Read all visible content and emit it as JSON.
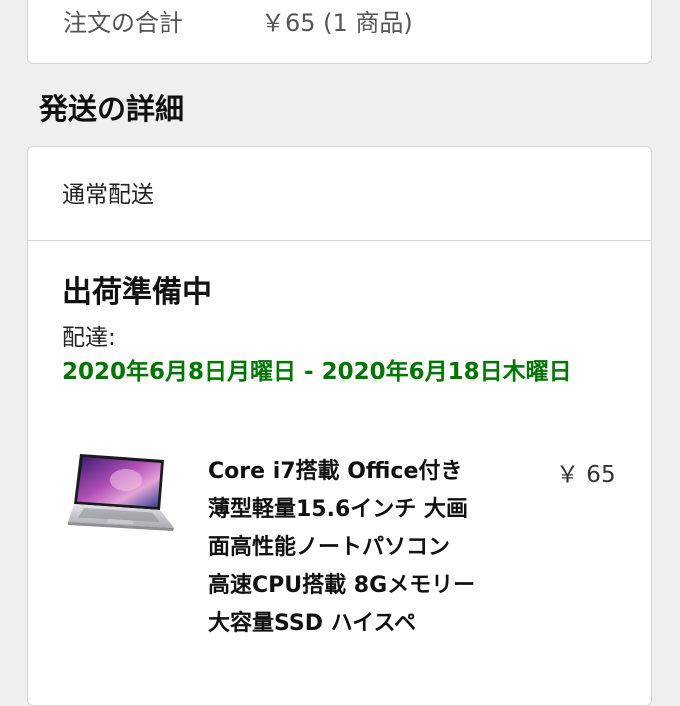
{
  "order_summary": {
    "total_label": "注文の合計",
    "total_value": "￥65 (1 商品)"
  },
  "shipping_details": {
    "section_title": "発送の詳細",
    "shipping_method": "通常配送",
    "status": "出荷準備中",
    "delivery_label": "配達:",
    "delivery_range": "2020年6月8日月曜日 - 2020年6月18日木曜日"
  },
  "product": {
    "image_icon": "laptop-image",
    "title": "Core i7搭載 Office付き 薄型軽量15.6インチ 大画面高性能ノートパソコン 高速CPU搭載 8Gメモリー 大容量SSD ハイスペ",
    "price": "￥ 65"
  },
  "colors": {
    "delivery_green": "#007600",
    "background": "#efefef",
    "card": "#ffffff",
    "border": "#d5d5d5"
  }
}
